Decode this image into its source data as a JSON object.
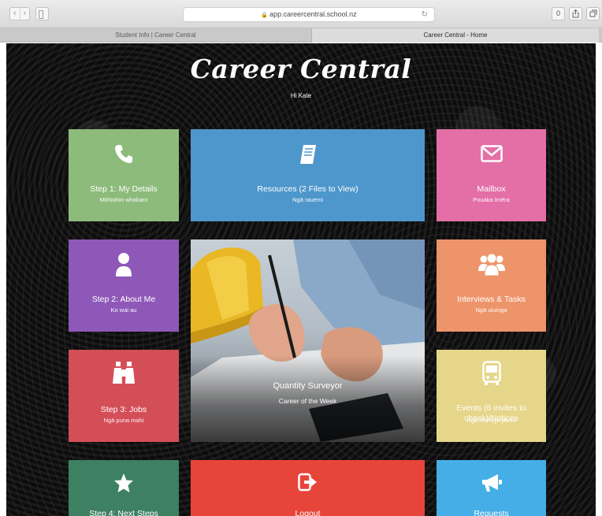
{
  "browser": {
    "url": "app.careercentral.school.nz",
    "tabs": [
      "Student Info | Career Central",
      "Career Central - Home"
    ],
    "nav_back": "‹",
    "nav_forward": "›",
    "ext_button": "0"
  },
  "page": {
    "brand": "Career Central",
    "greeting": "Hi Kate"
  },
  "tiles": {
    "details": {
      "title": "Step 1: My Details",
      "sub": "Mōhiohio whakaro",
      "icon": "phone-icon",
      "color": "#8dbb7c"
    },
    "resources": {
      "title": "Resources (2 Files to View)",
      "sub": "Ngā rauemi",
      "icon": "book-icon",
      "color": "#4e97cc"
    },
    "mailbox": {
      "title": "Mailbox",
      "sub": "Pouaka īmēra",
      "icon": "envelope-icon",
      "color": "#e46fa6"
    },
    "about": {
      "title": "Step 2: About Me",
      "sub": "Ko wai au",
      "icon": "user-icon",
      "color": "#8e58b8"
    },
    "interviews": {
      "title": "Interviews & Tasks",
      "sub": "Ngā uiuinga",
      "icon": "users-icon",
      "color": "#ee946b"
    },
    "jobs": {
      "title": "Step 3: Jobs",
      "sub": "Ngā puna mahi",
      "icon": "binoculars-icon",
      "color": "#d44e58"
    },
    "events": {
      "title": "Events (6 invites to check)/Notices",
      "sub": "Ngā hui/Ngā pānui",
      "icon": "bus-icon",
      "color": "#e6d68a"
    },
    "next": {
      "title": "Step 4: Next Steps",
      "icon": "star-icon",
      "color": "#3d8062"
    },
    "logout": {
      "title": "Logout",
      "icon": "sign-out-icon",
      "color": "#e8453a"
    },
    "requests": {
      "title": "Requests",
      "icon": "megaphone-icon",
      "color": "#45aee6"
    }
  },
  "feature": {
    "title": "Quantity Surveyor",
    "sub": "Career of the Week"
  }
}
